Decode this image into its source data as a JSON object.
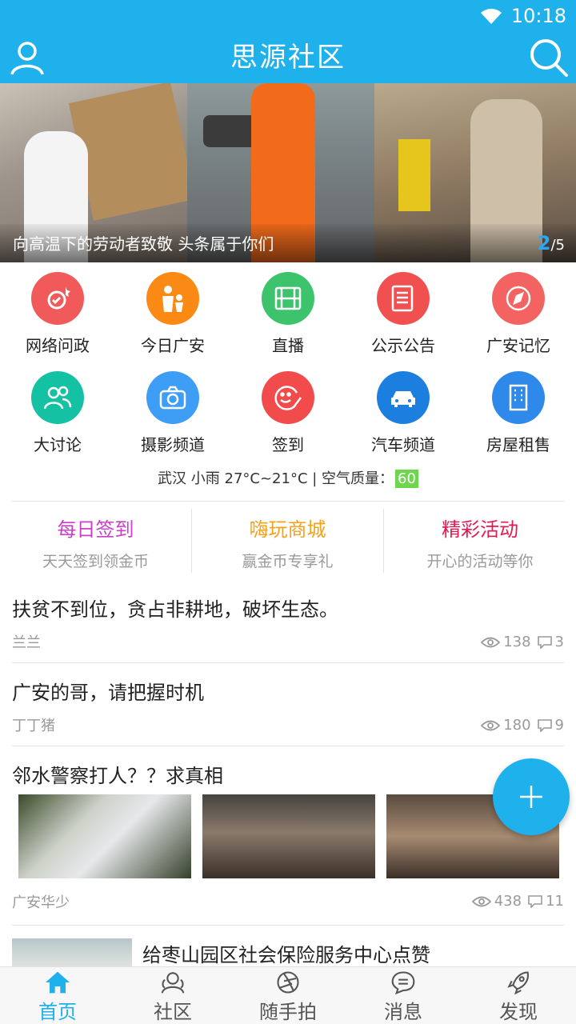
{
  "status": {
    "time": "10:18"
  },
  "appbar": {
    "title": "思源社区"
  },
  "banner": {
    "caption": "向高温下的劳动者致敬 头条属于你们",
    "current": "2",
    "total": "/5"
  },
  "grid": [
    {
      "label": "网络问政",
      "icon": "certificate-icon",
      "color": "#f05a5a"
    },
    {
      "label": "今日广安",
      "icon": "family-icon",
      "color": "#fb8a14"
    },
    {
      "label": "直播",
      "icon": "film-icon",
      "color": "#3dc36b"
    },
    {
      "label": "公示公告",
      "icon": "document-icon",
      "color": "#f0504f"
    },
    {
      "label": "广安记忆",
      "icon": "compass-icon",
      "color": "#f26361"
    },
    {
      "label": "大讨论",
      "icon": "users-icon",
      "color": "#14c1a3"
    },
    {
      "label": "摄影频道",
      "icon": "camera-icon",
      "color": "#3e9df5"
    },
    {
      "label": "签到",
      "icon": "smile-edit-icon",
      "color": "#f24b4b"
    },
    {
      "label": "汽车频道",
      "icon": "car-icon",
      "color": "#1c7fe0"
    },
    {
      "label": "房屋租售",
      "icon": "building-icon",
      "color": "#2f89ea"
    }
  ],
  "weather": {
    "text": "武汉 小雨 27°C~21°C | 空气质量：",
    "aqi": "60"
  },
  "promos": [
    {
      "title": "每日签到",
      "subtitle": "天天签到领金币",
      "color": "#c940c9"
    },
    {
      "title": "嗨玩商城",
      "subtitle": "赢金币专享礼",
      "color": "#f3a21a"
    },
    {
      "title": "精彩活动",
      "subtitle": "开心的活动等你",
      "color": "#e5184f"
    }
  ],
  "posts": [
    {
      "title": "扶贫不到位，贪占非耕地，破坏生态。",
      "author": "兰兰",
      "views": "138",
      "comments": "3"
    },
    {
      "title": "广安的哥，请把握时机",
      "author": "丁丁猪",
      "views": "180",
      "comments": "9"
    },
    {
      "title": "邻水警察打人？？求真相",
      "author": "广安华少",
      "views": "438",
      "comments": "11"
    },
    {
      "title": "给枣山园区社会保险服务中心点赞"
    }
  ],
  "nav": [
    {
      "label": "首页",
      "icon": "home-icon",
      "active": true
    },
    {
      "label": "社区",
      "icon": "community-icon"
    },
    {
      "label": "随手拍",
      "icon": "aperture-icon"
    },
    {
      "label": "消息",
      "icon": "message-icon"
    },
    {
      "label": "发现",
      "icon": "rocket-icon"
    }
  ],
  "colors": {
    "primary": "#1fb1ec",
    "aqi": "#6dd64c"
  }
}
